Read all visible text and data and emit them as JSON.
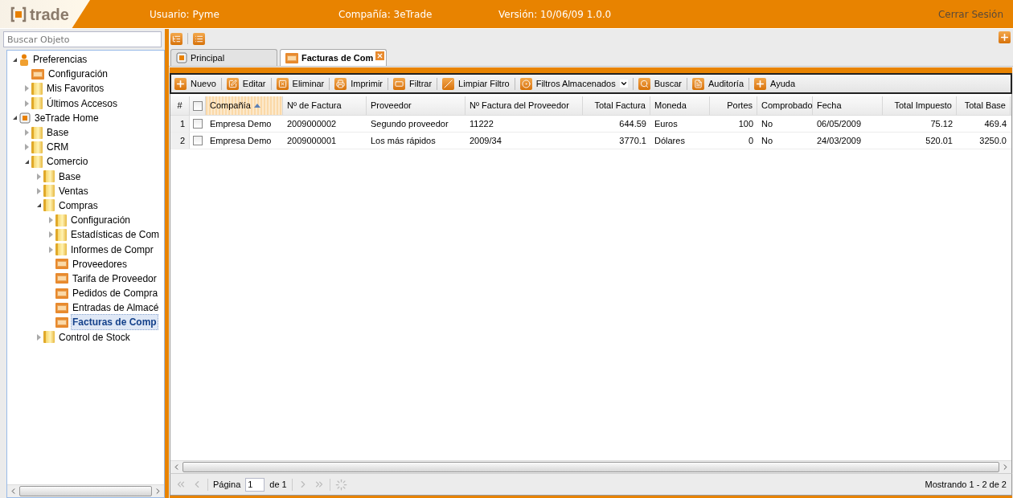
{
  "header": {
    "logo_text": "trade",
    "user": "Usuario: Pyme",
    "company": "Compañía: 3eTrade",
    "version": "Versión: 10/06/09 1.0.0",
    "logout": "Cerrar Sesión"
  },
  "search": {
    "placeholder": "Buscar Objeto"
  },
  "tree": [
    {
      "label": "Preferencias",
      "kind": "person",
      "expanded": true,
      "selected": false,
      "children": [
        {
          "label": "Configuración",
          "kind": "doc",
          "selected": false
        },
        {
          "label": "Mis Favoritos",
          "kind": "folder",
          "expanded": false,
          "selected": false
        },
        {
          "label": "Últimos Accesos",
          "kind": "folder",
          "expanded": false,
          "selected": false
        }
      ]
    },
    {
      "label": "3eTrade Home",
      "kind": "home",
      "expanded": true,
      "selected": false,
      "children": [
        {
          "label": "Base",
          "kind": "folder",
          "expanded": false,
          "selected": false
        },
        {
          "label": "CRM",
          "kind": "folder",
          "expanded": false,
          "selected": false
        },
        {
          "label": "Comercio",
          "kind": "folder",
          "expanded": true,
          "selected": false,
          "children": [
            {
              "label": "Base",
              "kind": "folder",
              "expanded": false,
              "selected": false
            },
            {
              "label": "Ventas",
              "kind": "folder",
              "expanded": false,
              "selected": false
            },
            {
              "label": "Compras",
              "kind": "folder",
              "expanded": true,
              "selected": false,
              "children": [
                {
                  "label": "Configuración",
                  "kind": "folder",
                  "expanded": false,
                  "selected": false
                },
                {
                  "label": "Estadísticas de Com",
                  "kind": "folder",
                  "expanded": false,
                  "selected": false
                },
                {
                  "label": "Informes de Compr",
                  "kind": "folder",
                  "expanded": false,
                  "selected": false
                },
                {
                  "label": "Proveedores",
                  "kind": "doc",
                  "selected": false
                },
                {
                  "label": "Tarifa de Proveedor",
                  "kind": "doc",
                  "selected": false
                },
                {
                  "label": "Pedidos de Compra",
                  "kind": "doc",
                  "selected": false
                },
                {
                  "label": "Entradas de Almacé",
                  "kind": "doc",
                  "selected": false
                },
                {
                  "label": "Facturas de Comp",
                  "kind": "doc",
                  "selected": true
                }
              ]
            },
            {
              "label": "Control de Stock",
              "kind": "folder",
              "expanded": false,
              "selected": false
            }
          ]
        }
      ]
    }
  ],
  "tabs": [
    {
      "label": "Principal",
      "selected": false,
      "closable": false
    },
    {
      "label": "Facturas de Com",
      "selected": true,
      "closable": true
    }
  ],
  "toolbar": [
    {
      "label": "Nuevo"
    },
    {
      "label": "Editar"
    },
    {
      "label": "Eliminar"
    },
    {
      "label": "Imprimir"
    },
    {
      "label": "Filtrar"
    },
    {
      "label": "Limpiar Filtro"
    },
    {
      "label": "Filtros Almacenados",
      "dropdown": true
    },
    {
      "label": "Buscar"
    },
    {
      "label": "Auditoría"
    },
    {
      "label": "Ayuda"
    }
  ],
  "table": {
    "index_header": "#",
    "select_all": {
      "checked": false
    },
    "columns": [
      {
        "label": "Compañía",
        "kind": "text",
        "sorted": true
      },
      {
        "label": "Nº de Factura",
        "kind": "text",
        "sorted": false
      },
      {
        "label": "Proveedor",
        "kind": "text",
        "sorted": false
      },
      {
        "label": "Nº Factura del Proveedor",
        "kind": "text",
        "sorted": false
      },
      {
        "label": "Total Factura",
        "kind": "number",
        "sorted": false
      },
      {
        "label": "Moneda",
        "kind": "text",
        "sorted": false
      },
      {
        "label": "Portes",
        "kind": "number",
        "sorted": false
      },
      {
        "label": "Comprobado",
        "kind": "text",
        "sorted": false
      },
      {
        "label": "Fecha",
        "kind": "text",
        "sorted": false
      },
      {
        "label": "Total Impuesto",
        "kind": "number",
        "sorted": false
      },
      {
        "label": "Total Base",
        "kind": "number",
        "sorted": false
      }
    ],
    "rows": [
      {
        "index": "1",
        "checked": false,
        "cells": [
          "Empresa Demo",
          "2009000002",
          "Segundo proveedor",
          "11222",
          "644.59",
          "Euros",
          "100",
          "No",
          "06/05/2009",
          "75.12",
          "469.4"
        ]
      },
      {
        "index": "2",
        "checked": false,
        "cells": [
          "Empresa Demo",
          "2009000001",
          "Los más rápidos",
          "2009/34",
          "3770.1",
          "Dólares",
          "0",
          "No",
          "24/03/2009",
          "520.01",
          "3250.0"
        ]
      }
    ]
  },
  "pager": {
    "page_label": "Página",
    "page_value": "1",
    "of_label": "de 1",
    "status": "Mostrando 1 - 2 de 2"
  }
}
